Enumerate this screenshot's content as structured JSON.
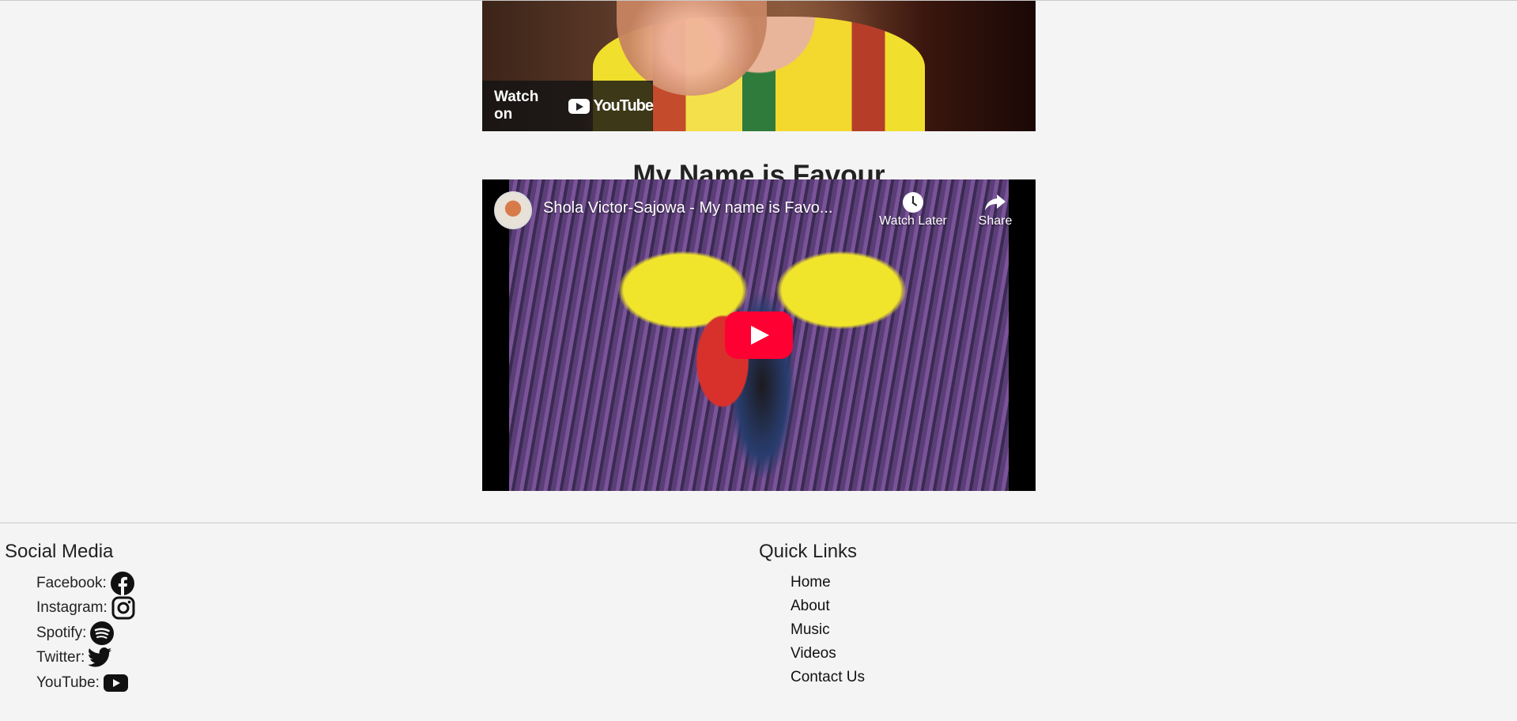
{
  "video_top": {
    "watch_on_label": "Watch on",
    "youtube_word": "YouTube"
  },
  "section_title": "My Name is Favour",
  "video_main": {
    "title": "Shola Victor-Sajowa - My name is Favo...",
    "watch_later_label": "Watch Later",
    "share_label": "Share"
  },
  "footer": {
    "social": {
      "heading": "Social Media",
      "items": [
        {
          "label": "Facebook:",
          "icon": "facebook-icon"
        },
        {
          "label": "Instagram:",
          "icon": "instagram-icon"
        },
        {
          "label": "Spotify:",
          "icon": "spotify-icon"
        },
        {
          "label": "Twitter:",
          "icon": "twitter-icon"
        },
        {
          "label": "YouTube:",
          "icon": "youtube-icon"
        }
      ]
    },
    "quick_links": {
      "heading": "Quick Links",
      "items": [
        "Home",
        "About",
        "Music",
        "Videos",
        "Contact Us"
      ]
    }
  },
  "colors": {
    "background": "#f4f4f4",
    "play_button": "#ff0033",
    "text": "#222222"
  }
}
